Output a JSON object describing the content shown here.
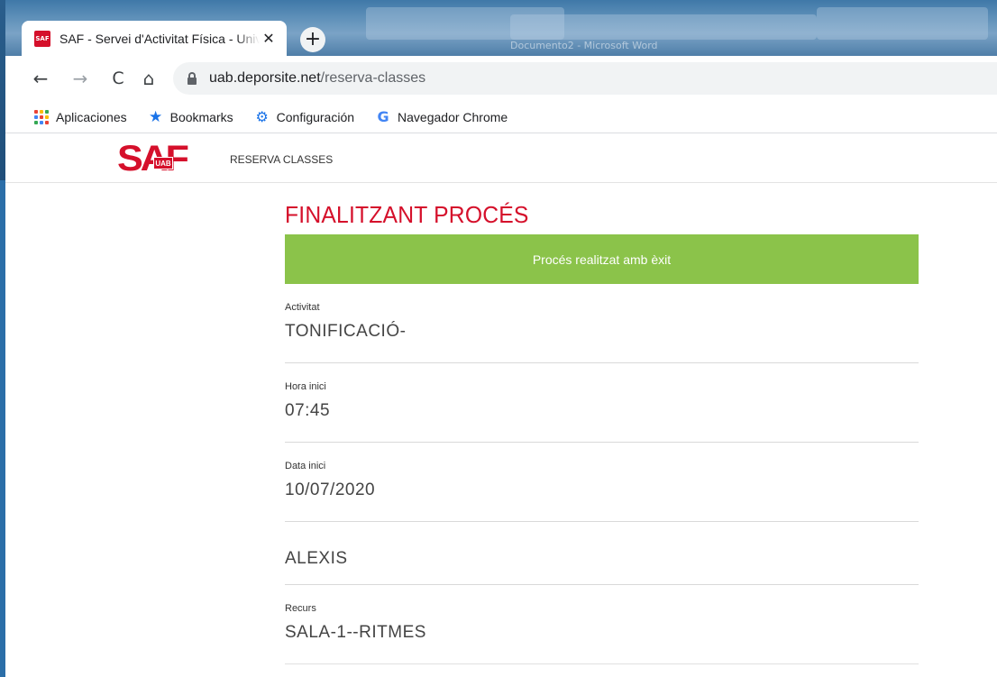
{
  "browser": {
    "tab": {
      "favicon_text": "SAF",
      "title": "SAF - Servei d'Activitat Física - Universitat Autònoma de Barcelona",
      "close_icon": "close-icon"
    },
    "new_tab_icon": "plus-icon",
    "background_window_label": "Documento2 - Microsoft Word",
    "url": {
      "host": "uab.deporsite.net",
      "path": "/reserva-classes"
    },
    "bookmarks": [
      {
        "label": "Aplicaciones",
        "icon": "apps-grid-icon"
      },
      {
        "label": "Bookmarks",
        "icon": "star-icon"
      },
      {
        "label": "Configuración",
        "icon": "gear-icon"
      },
      {
        "label": "Navegador Chrome",
        "icon": "google-icon"
      }
    ]
  },
  "site": {
    "logo_text": "SAF",
    "logo_sub": "UAB",
    "nav_label": "RESERVA CLASSES"
  },
  "main": {
    "title": "FINALITZANT PROCÉS",
    "banner": "Procés realitzat amb èxit",
    "fields": [
      {
        "label": "Activitat",
        "value": "TONIFICACIÓ-"
      },
      {
        "label": "Hora inici",
        "value": "07:45"
      },
      {
        "label": "Data inici",
        "value": "10/07/2020"
      },
      {
        "label": "",
        "value": "ALEXIS"
      },
      {
        "label": "Recurs",
        "value": "SALA-1--RITMES"
      }
    ]
  },
  "colors": {
    "brand_red": "#d5102b",
    "success_green": "#8bc34a"
  }
}
